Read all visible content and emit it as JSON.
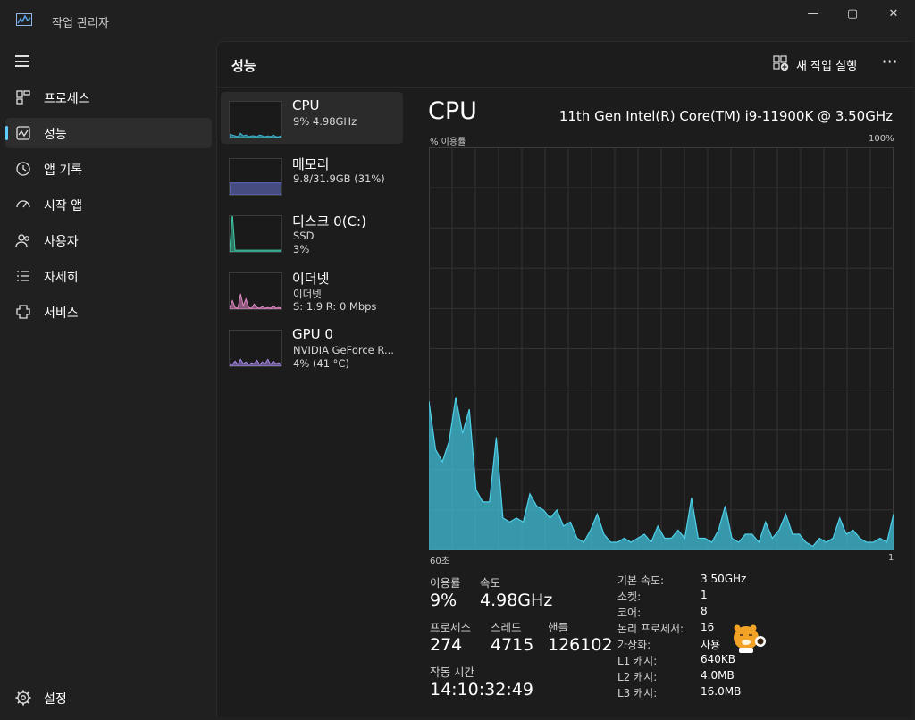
{
  "window": {
    "title": "작업 관리자",
    "controls": {
      "minimize": "—",
      "maximize": "▢",
      "close": "✕"
    }
  },
  "sidebar": {
    "items": [
      {
        "label": "프로세스",
        "icon": "processes-icon",
        "active": false
      },
      {
        "label": "성능",
        "icon": "performance-icon",
        "active": true
      },
      {
        "label": "앱 기록",
        "icon": "app-history-icon",
        "active": false
      },
      {
        "label": "시작 앱",
        "icon": "startup-apps-icon",
        "active": false
      },
      {
        "label": "사용자",
        "icon": "users-icon",
        "active": false
      },
      {
        "label": "자세히",
        "icon": "details-icon",
        "active": false
      },
      {
        "label": "서비스",
        "icon": "services-icon",
        "active": false
      }
    ],
    "settings_label": "설정"
  },
  "header": {
    "title": "성능",
    "new_task_label": "새 작업 실행",
    "more": "···"
  },
  "devices": [
    {
      "title": "CPU",
      "lines": [
        "9%  4.98GHz"
      ],
      "color": "#3fb8d0",
      "active": true
    },
    {
      "title": "메모리",
      "lines": [
        "9.8/31.9GB (31%)"
      ],
      "color": "#6b74d6",
      "active": false
    },
    {
      "title": "디스크 0(C:)",
      "lines": [
        "SSD",
        "3%"
      ],
      "color": "#3fc9a8",
      "active": false
    },
    {
      "title": "이더넷",
      "lines": [
        "이더넷",
        "S: 1.9  R: 0 Mbps"
      ],
      "color": "#e58ac8",
      "active": false
    },
    {
      "title": "GPU 0",
      "lines": [
        "NVIDIA GeForce R...",
        "4% (41 °C)"
      ],
      "color": "#a689e6",
      "active": false
    }
  ],
  "detail": {
    "heading": "CPU",
    "model": "11th Gen Intel(R) Core(TM) i9-11900K @ 3.50GHz",
    "graph_label_left": "% 이용률",
    "graph_label_right": "100%",
    "graph_time_left": "60초",
    "graph_time_right": "1",
    "stats": {
      "utilization_label": "이용률",
      "utilization_value": "9%",
      "speed_label": "속도",
      "speed_value": "4.98GHz",
      "processes_label": "프로세스",
      "processes_value": "274",
      "threads_label": "스레드",
      "threads_value": "4715",
      "handles_label": "핸들",
      "handles_value": "126102",
      "uptime_label": "작동 시간",
      "uptime_value": "14:10:32:49"
    },
    "specs": [
      {
        "key": "기본 속도:",
        "value": "3.50GHz"
      },
      {
        "key": "소켓:",
        "value": "1"
      },
      {
        "key": "코어:",
        "value": "8"
      },
      {
        "key": "논리 프로세서:",
        "value": "16"
      },
      {
        "key": "가상화:",
        "value": "사용"
      },
      {
        "key": "L1 캐시:",
        "value": "640KB"
      },
      {
        "key": "L2 캐시:",
        "value": "4.0MB"
      },
      {
        "key": "L3 캐시:",
        "value": "16.0MB"
      }
    ]
  },
  "chart_data": {
    "type": "area",
    "xlabel": "60초",
    "ylabel": "% 이용률",
    "ylim": [
      0,
      100
    ],
    "x": [
      60,
      59,
      58,
      57,
      56,
      55,
      54,
      53,
      52,
      51,
      50,
      49,
      48,
      47,
      46,
      45,
      44,
      43,
      42,
      41,
      40,
      39,
      38,
      37,
      36,
      35,
      34,
      33,
      32,
      31,
      30,
      29,
      28,
      27,
      26,
      25,
      24,
      23,
      22,
      21,
      20,
      19,
      18,
      17,
      16,
      15,
      14,
      13,
      12,
      11,
      10,
      9,
      8,
      7,
      6,
      5,
      4,
      3,
      2,
      1
    ],
    "series": [
      {
        "name": "CPU",
        "color": "#3fb8d0",
        "values": [
          37,
          25,
          22,
          27,
          38,
          29,
          35,
          15,
          12,
          12,
          28,
          8,
          7,
          8,
          7,
          14,
          11,
          10,
          8,
          10,
          6,
          7,
          3,
          2,
          5,
          9,
          4,
          2,
          2,
          3,
          2,
          3,
          4,
          2,
          6,
          3,
          3,
          5,
          3,
          13,
          3,
          3,
          2,
          5,
          11,
          3,
          2,
          4,
          4,
          2,
          7,
          3,
          5,
          9,
          4,
          4,
          2,
          1,
          3,
          2,
          3,
          8,
          4,
          5,
          3,
          2,
          2,
          3,
          2,
          9
        ]
      }
    ]
  }
}
